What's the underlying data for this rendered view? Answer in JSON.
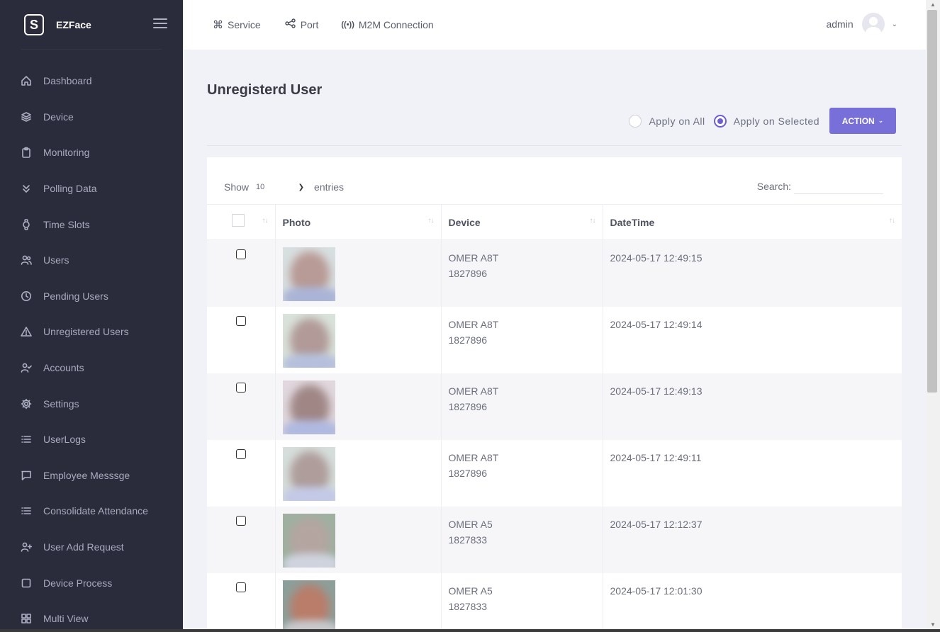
{
  "brand": {
    "logo_letter": "S",
    "name": "EZFace"
  },
  "sidebar": {
    "items": [
      {
        "label": "Dashboard",
        "icon": "home-icon"
      },
      {
        "label": "Device",
        "icon": "layers-icon"
      },
      {
        "label": "Monitoring",
        "icon": "clipboard-icon"
      },
      {
        "label": "Polling Data",
        "icon": "chevrons-down-icon"
      },
      {
        "label": "Time Slots",
        "icon": "watch-icon"
      },
      {
        "label": "Users",
        "icon": "users-icon"
      },
      {
        "label": "Pending Users",
        "icon": "clock-icon"
      },
      {
        "label": "Unregistered Users",
        "icon": "alert-triangle-icon"
      },
      {
        "label": "Accounts",
        "icon": "user-check-icon"
      },
      {
        "label": "Settings",
        "icon": "gear-icon"
      },
      {
        "label": "UserLogs",
        "icon": "list-icon"
      },
      {
        "label": "Employee Messsge",
        "icon": "message-square-icon"
      },
      {
        "label": "Consolidate Attendance",
        "icon": "list-icon"
      },
      {
        "label": "User Add Request",
        "icon": "user-plus-icon"
      },
      {
        "label": "Device Process",
        "icon": "square-icon"
      },
      {
        "label": "Multi View",
        "icon": "grid-icon"
      }
    ]
  },
  "topbar": {
    "links": [
      {
        "label": "Service",
        "icon": "command-icon",
        "glyph": "⌘"
      },
      {
        "label": "Port",
        "icon": "share-icon",
        "glyph": "⋖"
      },
      {
        "label": "M2M Connection",
        "icon": "broadcast-icon",
        "glyph": "((•))"
      }
    ],
    "user": "admin"
  },
  "page": {
    "title": "Unregisterd User",
    "apply_all": "Apply on All",
    "apply_selected": "Apply on Selected",
    "selected_option": "Apply on Selected",
    "action_label": "ACTION"
  },
  "table": {
    "show_label": "Show",
    "entries_value": "10",
    "entries_label": "entries",
    "search_label": "Search:",
    "search_value": "",
    "headers": [
      "Photo",
      "Device",
      "DateTime"
    ],
    "rows": [
      {
        "device_name": "OMER A8T",
        "device_id": "1827896",
        "datetime": "2024-05-17 12:49:15"
      },
      {
        "device_name": "OMER A8T",
        "device_id": "1827896",
        "datetime": "2024-05-17 12:49:14"
      },
      {
        "device_name": "OMER A8T",
        "device_id": "1827896",
        "datetime": "2024-05-17 12:49:13"
      },
      {
        "device_name": "OMER A8T",
        "device_id": "1827896",
        "datetime": "2024-05-17 12:49:11"
      },
      {
        "device_name": "OMER A5",
        "device_id": "1827833",
        "datetime": "2024-05-17 12:12:37"
      },
      {
        "device_name": "OMER A5",
        "device_id": "1827833",
        "datetime": "2024-05-17 12:01:30"
      }
    ]
  },
  "colors": {
    "sidebar_bg": "#2a2c3c",
    "content_bg": "#f1f2f7",
    "accent": "#786fd8"
  }
}
